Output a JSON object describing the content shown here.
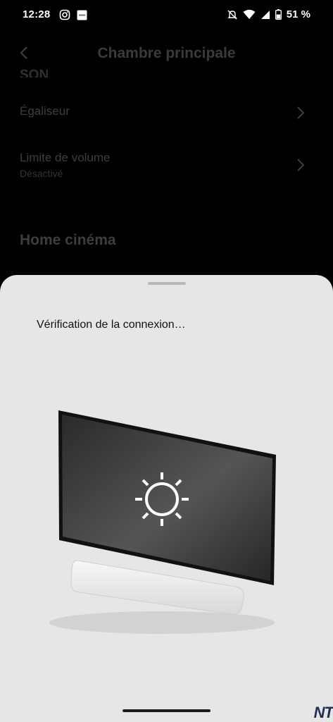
{
  "status_bar": {
    "time": "12:28",
    "battery_percent": "51 %",
    "icons": [
      "instagram-icon",
      "app-notification-icon",
      "mute-icon",
      "wifi-icon",
      "signal-icon",
      "battery-icon"
    ]
  },
  "background_page": {
    "title": "Chambre principale",
    "section_partial": "SON",
    "equalizer_label": "Égaliseur",
    "volume_limit_label": "Limite de volume",
    "volume_limit_value": "Désactivé",
    "home_cinema_title": "Home cinéma"
  },
  "sheet": {
    "message": "Vérification de la connexion…",
    "illustration": "tv-with-soundbar-settings-gear"
  },
  "watermark": "NT",
  "colors": {
    "sheet_bg": "#e6e6e6",
    "overlay": "#000000"
  }
}
